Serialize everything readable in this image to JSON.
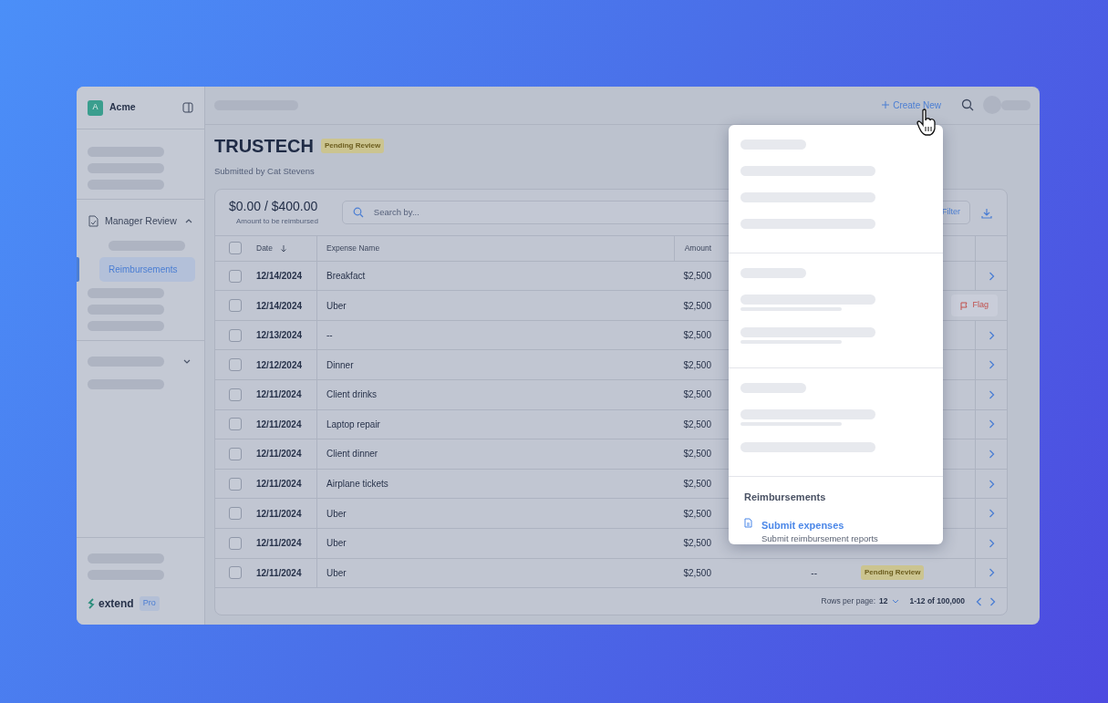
{
  "workspace": {
    "initial": "A",
    "name": "Acme"
  },
  "sidebar": {
    "items": [
      {
        "kind": "skeleton"
      },
      {
        "kind": "skeleton"
      },
      {
        "kind": "skeleton"
      },
      {
        "kind": "divider"
      },
      {
        "kind": "group",
        "label": "Manager Review",
        "expanded": true
      },
      {
        "kind": "subskeleton"
      },
      {
        "kind": "link",
        "label": "Reimbursements",
        "selected": true
      },
      {
        "kind": "skeleton"
      },
      {
        "kind": "skeleton"
      },
      {
        "kind": "skeleton"
      },
      {
        "kind": "divider"
      },
      {
        "kind": "skeleton-group",
        "expanded": false
      },
      {
        "kind": "skeleton"
      }
    ],
    "bottom": [
      {
        "kind": "skeleton"
      },
      {
        "kind": "skeleton"
      }
    ],
    "logo": "extend",
    "plan": "Pro"
  },
  "topbar": {
    "create_label": "Create New"
  },
  "report": {
    "title": "TRUSTECH",
    "status": "Pending Review",
    "submitted": "Submitted by Cat Stevens",
    "amount": "$0.00 / $400.00",
    "amount_caption": "Amount to be reimbursed",
    "search": {
      "placeholder": "Search by..."
    },
    "filter_label": "Filter"
  },
  "table": {
    "select_all_checked": false,
    "columns": [
      {
        "label": "Date",
        "sorted": true
      },
      {
        "label": "Expense Name",
        "sorted": false
      },
      {
        "label": "Amount",
        "sorted": false
      }
    ],
    "rows": [
      {
        "checked": false,
        "date": "12/14/2024",
        "name": "Breakfact",
        "amount": "$2,500"
      },
      {
        "checked": false,
        "date": "12/14/2024",
        "name": "Uber",
        "amount": "$2,500",
        "flag": "Flag"
      },
      {
        "checked": false,
        "date": "12/13/2024",
        "name": "--",
        "amount": "$2,500"
      },
      {
        "checked": false,
        "date": "12/12/2024",
        "name": "Dinner",
        "amount": "$2,500"
      },
      {
        "checked": false,
        "date": "12/11/2024",
        "name": "Client drinks",
        "amount": "$2,500"
      },
      {
        "checked": false,
        "date": "12/11/2024",
        "name": "Laptop repair",
        "amount": "$2,500"
      },
      {
        "checked": false,
        "date": "12/11/2024",
        "name": "Client dinner",
        "amount": "$2,500"
      },
      {
        "checked": false,
        "date": "12/11/2024",
        "name": "Airplane tickets",
        "amount": "$2,500"
      },
      {
        "checked": false,
        "date": "12/11/2024",
        "name": "Uber",
        "amount": "$2,500"
      },
      {
        "checked": false,
        "date": "12/11/2024",
        "name": "Uber",
        "amount": "$2,500"
      },
      {
        "checked": false,
        "date": "12/11/2024",
        "name": "Uber",
        "amount": "$2,500",
        "column_4": "--",
        "column_5": "Pending Review"
      }
    ]
  },
  "pagination": {
    "rows_label": "Rows per page:",
    "rows_value": "12",
    "range": "1-12 of 100,000"
  },
  "menu": {
    "heading": "Reimbursements",
    "items": [
      {
        "title": "Submit expenses",
        "subtitle": "Submit reimbursement reports"
      }
    ]
  }
}
